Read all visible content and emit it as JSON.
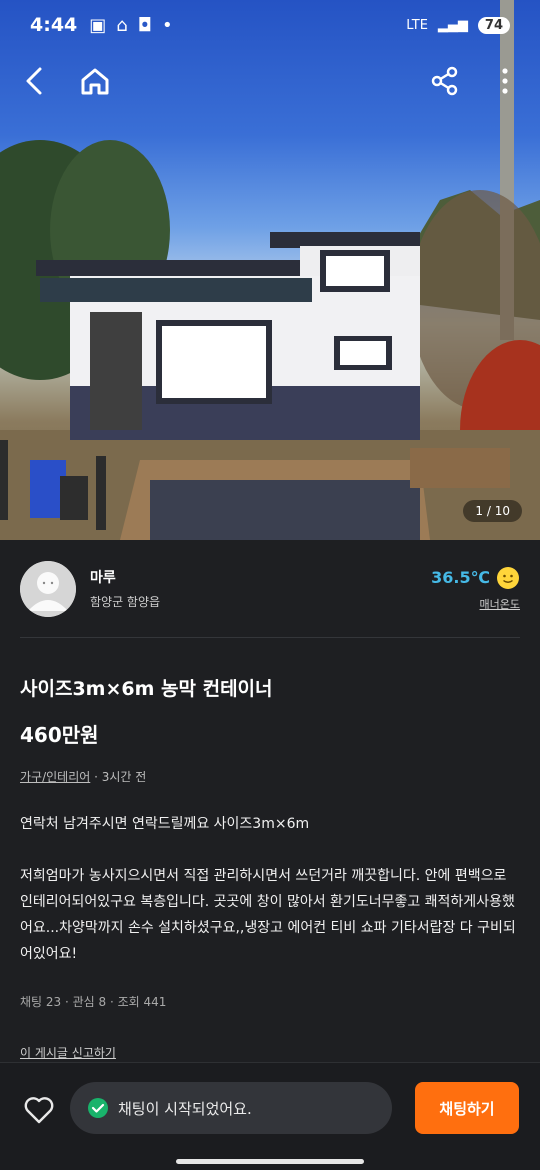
{
  "status_bar": {
    "time": "4:44",
    "network": "LTE",
    "battery": "74"
  },
  "hero": {
    "counter": "1 / 10"
  },
  "seller": {
    "name": "마루",
    "location": "함양군 함양읍",
    "temperature": "36.5℃",
    "temperature_label": "매너온도"
  },
  "post": {
    "title": "사이즈3m×6m 농막 컨테이너",
    "price": "460만원",
    "category": "가구/인테리어",
    "time_ago": " · 3시간 전",
    "body": [
      "연락처 남겨주시면 연락드릴께요 사이즈3m×6m",
      "저희엄마가 농사지으시면서 직접 관리하시면서 쓰던거라 깨끗합니다. 안에 편백으로 인테리어되어있구요 복층입니다. 곳곳에 창이 많아서 환기도너무좋고 쾌적하게사용했어요...차양막까지 손수 설치하셨구요,,냉장고 에어컨 티비 쇼파 기타서랍장 다 구비되어있어요!"
    ],
    "stats": "채팅 23 · 관심 8 · 조회 441",
    "report_link": "이 게시글 신고하기"
  },
  "bottom_bar": {
    "toast": "채팅이 시작되었어요.",
    "chat_button": "채팅하기"
  },
  "colors": {
    "accent": "#ff6f0f",
    "temperature": "#46b9e6",
    "background": "#1e1f22"
  }
}
